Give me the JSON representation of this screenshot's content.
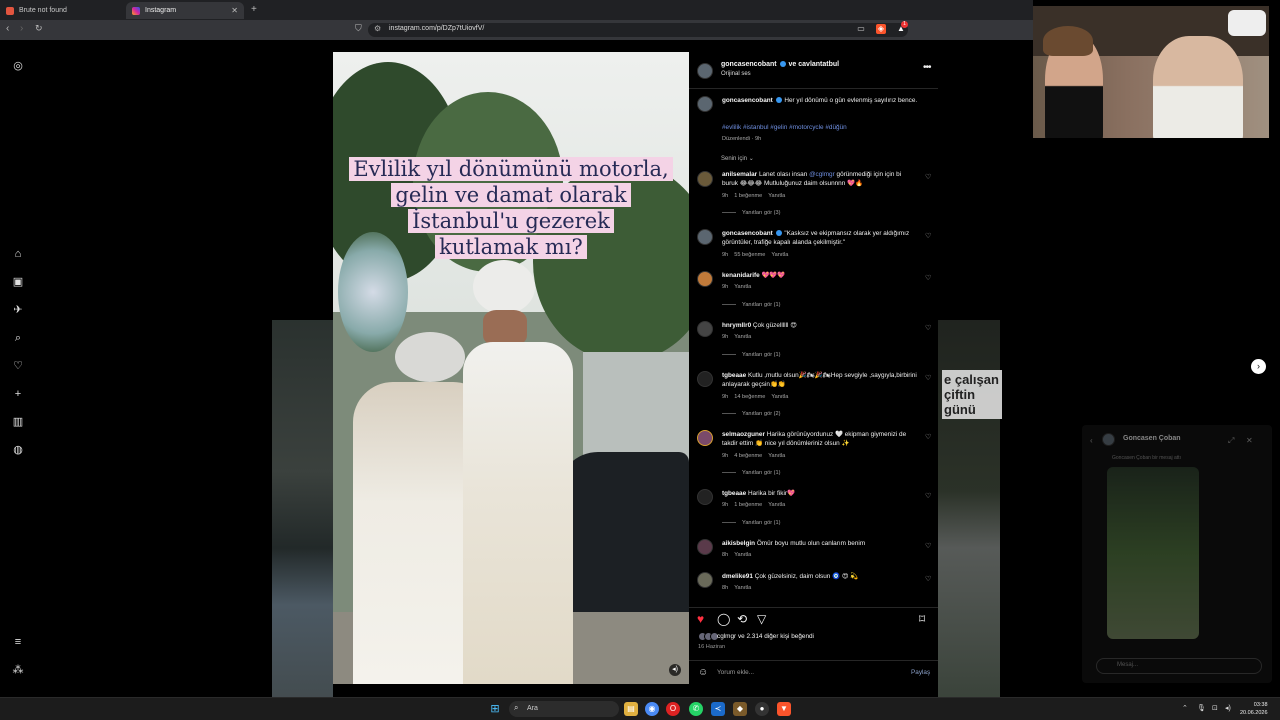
{
  "browser": {
    "tabs": [
      {
        "title": "Brute not found",
        "favicon_color": "#e2553f"
      },
      {
        "title": "Instagram",
        "favicon_color": "#d6249f"
      }
    ],
    "url": "instagram.com/p/DZp7tUiovfV/",
    "badge_count": "1"
  },
  "post": {
    "overlay_lines": [
      "Evlilik yıl dönümünü motorla,",
      "gelin ve damat olarak",
      "İstanbul'u gezerek",
      "kutlamak mı?"
    ],
    "header_user": "goncasencobant",
    "header_collab": "ve cavlantatbul",
    "audio": "Orijinal ses",
    "caption_user": "goncasencobant",
    "caption_text": "Her yıl dönümü o gün evlenmiş sayılırız bence.",
    "hashtags": "#evlilik #istanbul #gelin #motorcycle #düğün",
    "caption_meta": "Düzenlendi · 9h",
    "sort_label": "Senin için"
  },
  "comments": [
    {
      "user": "anilsemalar",
      "text_pre": "Lanet olası insan ",
      "mention": "@cglmgr",
      "text_post": " görünmediği için için bi buruk 😂😂😂 Mutluluğunuz daim olsunnnn 💖🔥",
      "time": "9h",
      "likes": "1 beğenme",
      "reply": "Yanıtla",
      "replies": "Yanıtları gör (3)"
    },
    {
      "user": "goncasencobant",
      "text_pre": "\"Kasksız ve ekipmansız olarak yer aldığımız görüntüler, trafiğe kapalı alanda çekilmiştir.\"",
      "mention": "",
      "text_post": "",
      "time": "9h",
      "likes": "55 beğenme",
      "reply": "Yanıtla",
      "replies": ""
    },
    {
      "user": "kenanidarife",
      "text_pre": "💖💖💖",
      "mention": "",
      "text_post": "",
      "time": "9h",
      "likes": "",
      "reply": "Yanıtla",
      "replies": "Yanıtları gör (1)"
    },
    {
      "user": "hnrymllr0",
      "text_pre": "Çok güzellllll 😍",
      "mention": "",
      "text_post": "",
      "time": "9h",
      "likes": "",
      "reply": "Yanıtla",
      "replies": "Yanıtları gör (1)"
    },
    {
      "user": "tgbeaae",
      "text_pre": "Kutlu ,mutlu olsun🎉🏍🎉🏍Hep sevgiyle ,saygıyla,birbirini anlayarak geçsin👏👏",
      "mention": "",
      "text_post": "",
      "time": "9h",
      "likes": "14 beğenme",
      "reply": "Yanıtla",
      "replies": "Yanıtları gör (2)"
    },
    {
      "user": "selmaozguner",
      "text_pre": "Harika görünüyordunuz 🤍 ekipman giymenizi de takdir ettim 👏 nice yıl dönümleriniz olsun ✨",
      "mention": "",
      "text_post": "",
      "time": "9h",
      "likes": "4 beğenme",
      "reply": "Yanıtla",
      "replies": "Yanıtları gör (1)"
    },
    {
      "user": "tgbeaae",
      "text_pre": "Harika bir fikir💖",
      "mention": "",
      "text_post": "",
      "time": "9h",
      "likes": "1 beğenme",
      "reply": "Yanıtla",
      "replies": "Yanıtları gör (1)"
    },
    {
      "user": "aikisbelgin",
      "text_pre": "Ömür boyu mutlu olun canlarım benim",
      "mention": "",
      "text_post": "",
      "time": "8h",
      "likes": "",
      "reply": "Yanıtla",
      "replies": ""
    },
    {
      "user": "dmelike91",
      "text_pre": "Çok güzelsiniz, daim olsun 🧿 😍 💫",
      "mention": "",
      "text_post": "",
      "time": "8h",
      "likes": "",
      "reply": "Yanıtla",
      "replies": ""
    }
  ],
  "actions": {
    "liked_by": "cglmgr ve 2.314 diğer kişi beğendi",
    "date": "16 Haziran",
    "comment_placeholder": "Yorum ekle...",
    "share_label": "Paylaş"
  },
  "background_caption": "e çalışan çiftin günü",
  "chat": {
    "name": "Goncasen Çoban",
    "sub": "Goncasen Çoban bir mesaj attı",
    "placeholder": "Mesaj..."
  },
  "taskbar": {
    "search_label": "Ara",
    "time": "03:38",
    "date": "20.06.2026"
  },
  "colors": {
    "like_red": "#ff3040",
    "accent_blue": "#3797f0",
    "overlay_bg": "#f4d3e6",
    "overlay_text": "#262a55"
  }
}
